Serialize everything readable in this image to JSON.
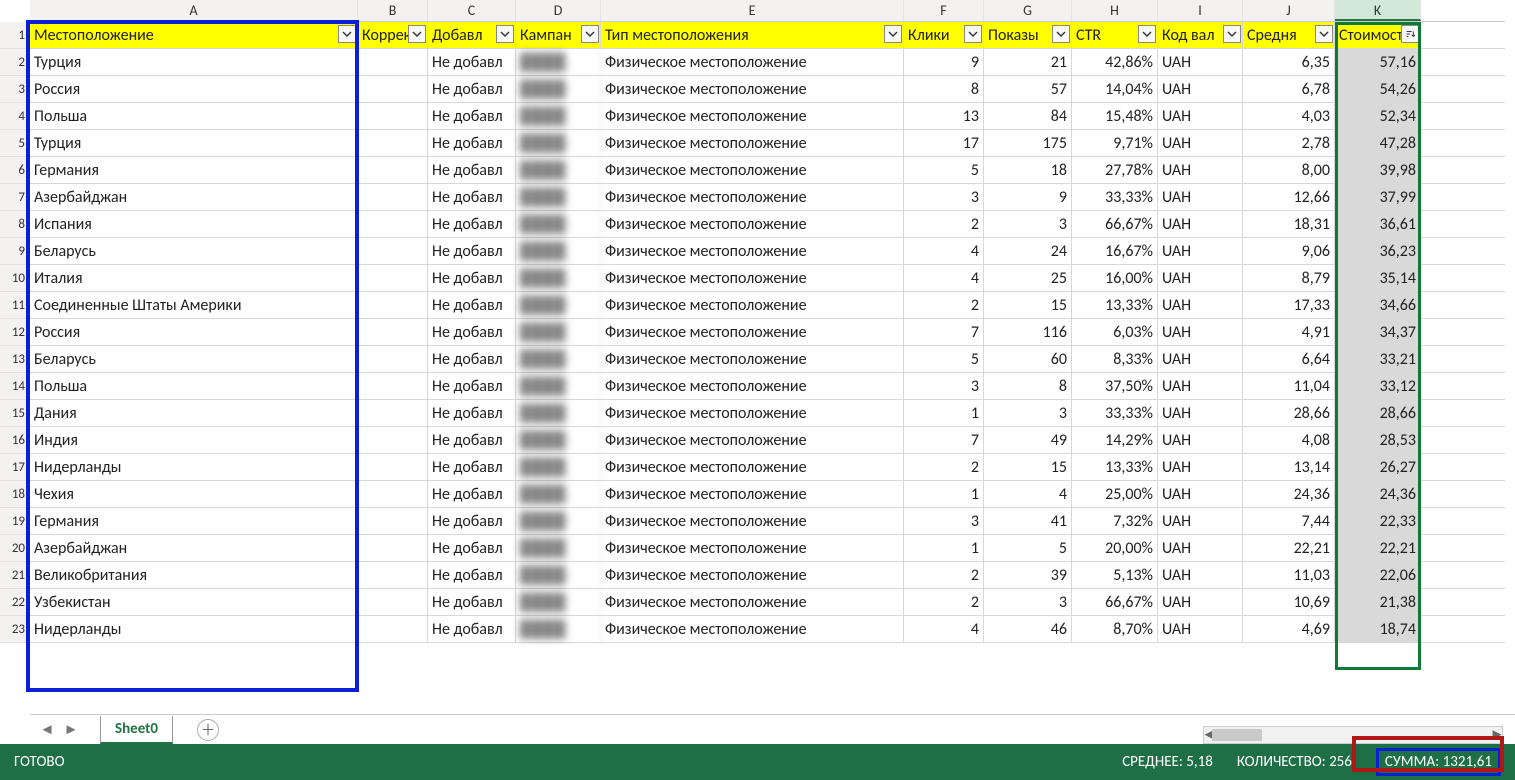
{
  "columns_letters": [
    "A",
    "B",
    "C",
    "D",
    "E",
    "F",
    "G",
    "H",
    "I",
    "J",
    "K"
  ],
  "headers": {
    "A": "Местоположение",
    "B": "Коррек",
    "C": "Добавл",
    "D": "Кампан",
    "E": "Тип местоположения",
    "F": "Клики",
    "G": "Показы",
    "H": "CTR",
    "I": "Код вал",
    "J": "Средня",
    "K": "Стоимост"
  },
  "rows": [
    {
      "n": 2,
      "A": "Турция",
      "C": "Не добавл",
      "E": "Физическое местоположение",
      "F": 9,
      "G": 21,
      "H": "42,86%",
      "I": "UAH",
      "J": "6,35",
      "K": "57,16"
    },
    {
      "n": 3,
      "A": "Россия",
      "C": "Не добавл",
      "E": "Физическое местоположение",
      "F": 8,
      "G": 57,
      "H": "14,04%",
      "I": "UAH",
      "J": "6,78",
      "K": "54,26"
    },
    {
      "n": 4,
      "A": "Польша",
      "C": "Не добавл",
      "E": "Физическое местоположение",
      "F": 13,
      "G": 84,
      "H": "15,48%",
      "I": "UAH",
      "J": "4,03",
      "K": "52,34"
    },
    {
      "n": 5,
      "A": "Турция",
      "C": "Не добавл",
      "E": "Физическое местоположение",
      "F": 17,
      "G": 175,
      "H": "9,71%",
      "I": "UAH",
      "J": "2,78",
      "K": "47,28"
    },
    {
      "n": 6,
      "A": "Германия",
      "C": "Не добавл",
      "E": "Физическое местоположение",
      "F": 5,
      "G": 18,
      "H": "27,78%",
      "I": "UAH",
      "J": "8,00",
      "K": "39,98"
    },
    {
      "n": 7,
      "A": "Азербайджан",
      "C": "Не добавл",
      "E": "Физическое местоположение",
      "F": 3,
      "G": 9,
      "H": "33,33%",
      "I": "UAH",
      "J": "12,66",
      "K": "37,99"
    },
    {
      "n": 8,
      "A": "Испания",
      "C": "Не добавл",
      "E": "Физическое местоположение",
      "F": 2,
      "G": 3,
      "H": "66,67%",
      "I": "UAH",
      "J": "18,31",
      "K": "36,61"
    },
    {
      "n": 9,
      "A": "Беларусь",
      "C": "Не добавл",
      "E": "Физическое местоположение",
      "F": 4,
      "G": 24,
      "H": "16,67%",
      "I": "UAH",
      "J": "9,06",
      "K": "36,23"
    },
    {
      "n": 10,
      "A": "Италия",
      "C": "Не добавл",
      "E": "Физическое местоположение",
      "F": 4,
      "G": 25,
      "H": "16,00%",
      "I": "UAH",
      "J": "8,79",
      "K": "35,14"
    },
    {
      "n": 11,
      "A": "Соединенные Штаты Америки",
      "C": "Не добавл",
      "E": "Физическое местоположение",
      "F": 2,
      "G": 15,
      "H": "13,33%",
      "I": "UAH",
      "J": "17,33",
      "K": "34,66"
    },
    {
      "n": 12,
      "A": "Россия",
      "C": "Не добавл",
      "E": "Физическое местоположение",
      "F": 7,
      "G": 116,
      "H": "6,03%",
      "I": "UAH",
      "J": "4,91",
      "K": "34,37"
    },
    {
      "n": 13,
      "A": "Беларусь",
      "C": "Не добавл",
      "E": "Физическое местоположение",
      "F": 5,
      "G": 60,
      "H": "8,33%",
      "I": "UAH",
      "J": "6,64",
      "K": "33,21"
    },
    {
      "n": 14,
      "A": "Польша",
      "C": "Не добавл",
      "E": "Физическое местоположение",
      "F": 3,
      "G": 8,
      "H": "37,50%",
      "I": "UAH",
      "J": "11,04",
      "K": "33,12"
    },
    {
      "n": 15,
      "A": "Дания",
      "C": "Не добавл",
      "E": "Физическое местоположение",
      "F": 1,
      "G": 3,
      "H": "33,33%",
      "I": "UAH",
      "J": "28,66",
      "K": "28,66"
    },
    {
      "n": 16,
      "A": "Индия",
      "C": "Не добавл",
      "E": "Физическое местоположение",
      "F": 7,
      "G": 49,
      "H": "14,29%",
      "I": "UAH",
      "J": "4,08",
      "K": "28,53"
    },
    {
      "n": 17,
      "A": "Нидерланды",
      "C": "Не добавл",
      "E": "Физическое местоположение",
      "F": 2,
      "G": 15,
      "H": "13,33%",
      "I": "UAH",
      "J": "13,14",
      "K": "26,27"
    },
    {
      "n": 18,
      "A": "Чехия",
      "C": "Не добавл",
      "E": "Физическое местоположение",
      "F": 1,
      "G": 4,
      "H": "25,00%",
      "I": "UAH",
      "J": "24,36",
      "K": "24,36"
    },
    {
      "n": 19,
      "A": "Германия",
      "C": "Не добавл",
      "E": "Физическое местоположение",
      "F": 3,
      "G": 41,
      "H": "7,32%",
      "I": "UAH",
      "J": "7,44",
      "K": "22,33"
    },
    {
      "n": 20,
      "A": "Азербайджан",
      "C": "Не добавл",
      "E": "Физическое местоположение",
      "F": 1,
      "G": 5,
      "H": "20,00%",
      "I": "UAH",
      "J": "22,21",
      "K": "22,21"
    },
    {
      "n": 21,
      "A": "Великобритания",
      "C": "Не добавл",
      "E": "Физическое местоположение",
      "F": 2,
      "G": 39,
      "H": "5,13%",
      "I": "UAH",
      "J": "11,03",
      "K": "22,06"
    },
    {
      "n": 22,
      "A": "Узбекистан",
      "C": "Не добавл",
      "E": "Физическое местоположение",
      "F": 2,
      "G": 3,
      "H": "66,67%",
      "I": "UAH",
      "J": "10,69",
      "K": "21,38"
    },
    {
      "n": 23,
      "A": "Нидерланды",
      "C": "Не добавл",
      "E": "Физическое местоположение",
      "F": 4,
      "G": 46,
      "H": "8,70%",
      "I": "UAH",
      "J": "4,69",
      "K": "18,74"
    }
  ],
  "sheet_tab": "Sheet0",
  "status": {
    "ready": "ГОТОВО",
    "avg_label": "СРЕДНЕЕ:",
    "avg_value": "5,18",
    "count_label": "КОЛИЧЕСТВО:",
    "count_value": "256",
    "sum_label": "СУММА:",
    "sum_value": "1321,61"
  },
  "selected_column": "K",
  "sort_indicator_column": "K"
}
